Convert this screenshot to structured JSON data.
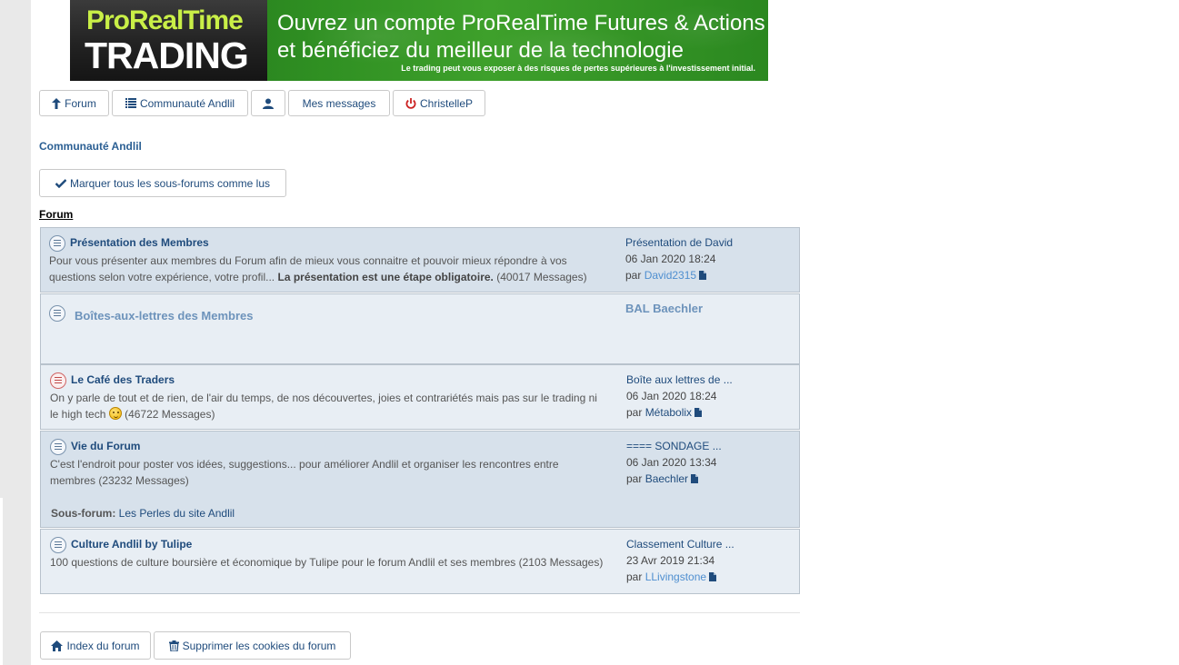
{
  "banner": {
    "logo_top": "ProRealTime",
    "logo_bottom": "TRADING",
    "tagline_1": "Ouvrez un compte ProRealTime Futures & Actions",
    "tagline_2": "et bénéficiez du meilleur de la technologie",
    "disclaimer": "Le trading peut vous exposer à des risques de pertes supérieures à l'investissement initial."
  },
  "nav": {
    "forum": "Forum",
    "community": "Communauté Andlil",
    "messages": "Mes messages",
    "user": "ChristelleP"
  },
  "section_title": "Communauté Andlil",
  "mark_read_label": "Marquer tous les sous-forums comme lus",
  "forum_heading": "Forum",
  "forums": [
    {
      "name": "Présentation des Membres",
      "desc_plain": "Pour vous présenter aux membres du Forum afin de mieux vous connaitre et pouvoir mieux répondre à vos questions selon votre expérience, votre profil...",
      "desc_bold": "La présentation est une étape obligatoire.",
      "count": "(40017 Messages)",
      "last_title": "Présentation de David",
      "last_date": "06 Jan 2020 18:24",
      "last_by_prefix": "par",
      "last_user": "David2315"
    },
    {
      "name": "Boîtes-aux-lettres des Membres",
      "last_title": "BAL Baechler"
    },
    {
      "name": "Le Café des Traders",
      "desc_plain": "On y parle de tout et de rien, de l'air du temps, de nos découvertes, joies et contrariétés mais pas sur le trading ni le high tech",
      "count": "(46722 Messages)",
      "last_title": "Boîte aux lettres de ...",
      "last_date": "06 Jan 2020 18:24",
      "last_by_prefix": "par",
      "last_user": "Métabolix"
    },
    {
      "name": "Vie du Forum",
      "desc_plain": "C'est l'endroit pour poster vos idées, suggestions... pour améliorer Andlil et organiser les rencontres entre membres",
      "count": "(23232 Messages)",
      "subforum_label": "Sous-forum:",
      "subforum_link": "Les Perles du site Andlil",
      "last_title": "==== SONDAGE ...",
      "last_date": "06 Jan 2020 13:34",
      "last_by_prefix": "par",
      "last_user": "Baechler"
    },
    {
      "name": "Culture Andlil by Tulipe",
      "desc_plain": "100 questions de culture boursière et économique by Tulipe pour le forum Andlil et ses membres",
      "count": "(2103 Messages)",
      "last_title": "Classement Culture ...",
      "last_date": "23 Avr 2019 21:34",
      "last_by_prefix": "par",
      "last_user": "LLivingstone"
    }
  ],
  "footer": {
    "index": "Index du forum",
    "cookies": "Supprimer les cookies du forum"
  },
  "colors": {
    "link": "#1f4b7c",
    "row_dark": "#d7e1eb",
    "row_light": "#e8eef4",
    "power_icon": "#cc2222"
  },
  "icons": [
    "arrow-up-icon",
    "list-icon",
    "user-icon",
    "power-icon",
    "check-icon",
    "forum-icon",
    "document-icon",
    "smiley-icon",
    "home-icon",
    "trash-icon"
  ]
}
